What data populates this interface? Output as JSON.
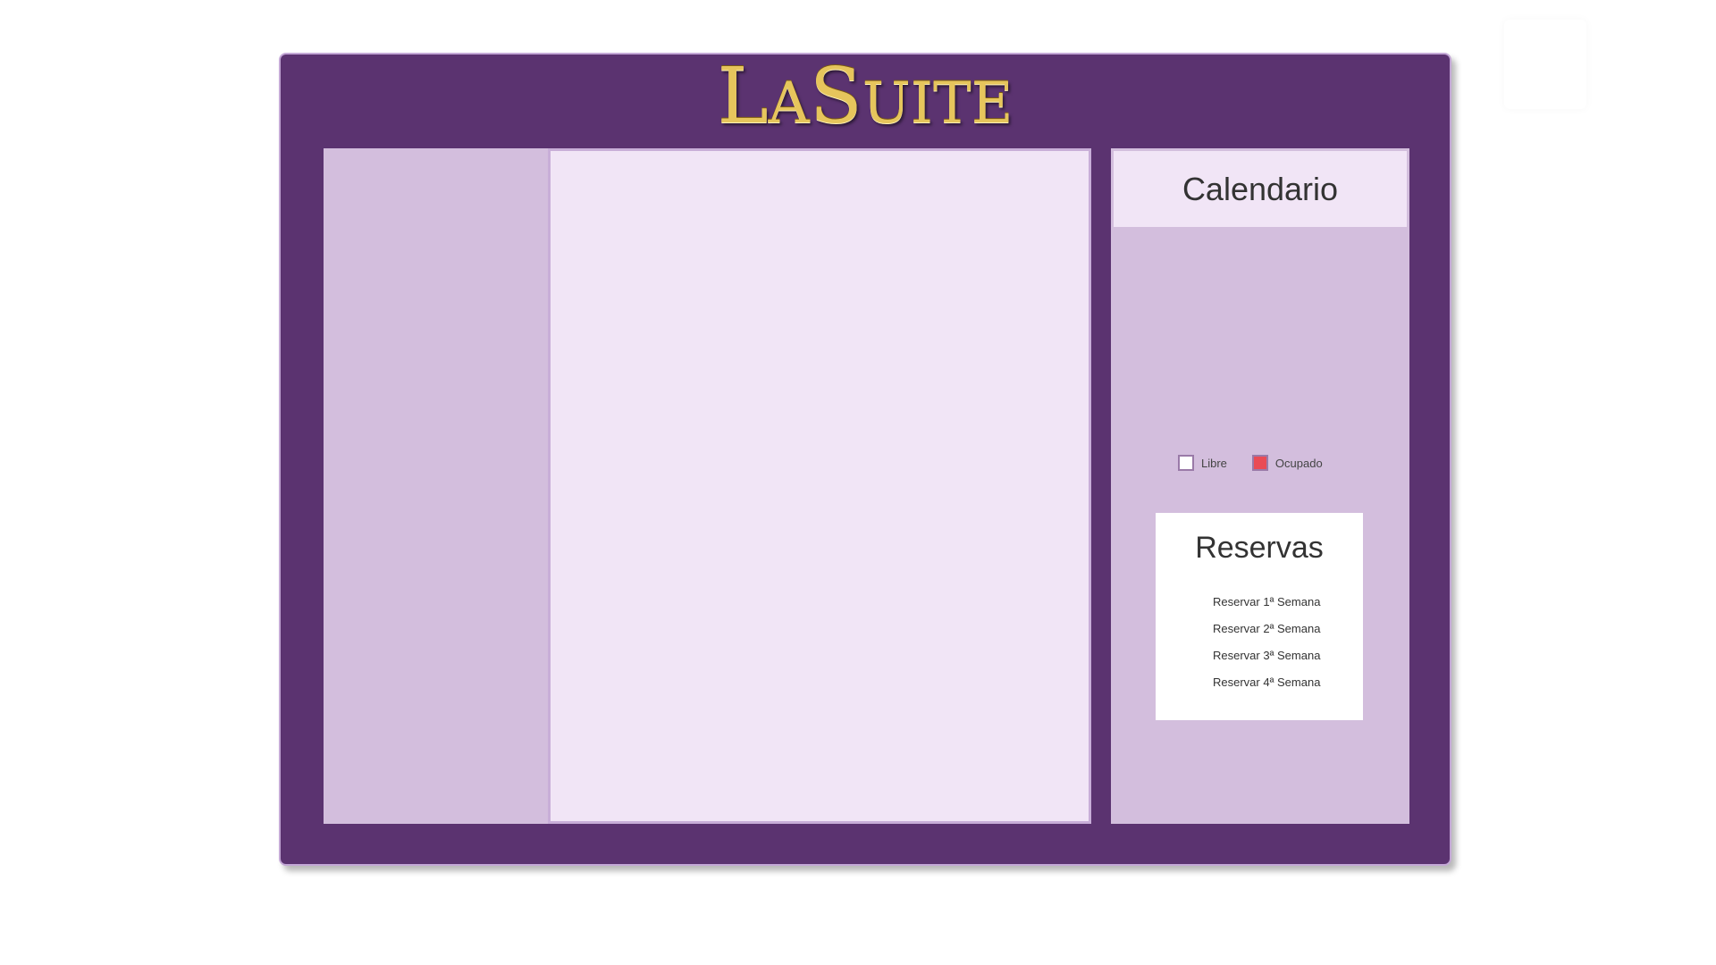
{
  "header": {
    "logo_first_letter": "L",
    "logo_part1": "A",
    "logo_second_letter": "S",
    "logo_part2": "UITE"
  },
  "calendar": {
    "title": "Calendario"
  },
  "legend": {
    "items": [
      {
        "label": "Libre",
        "color": "#ffffff"
      },
      {
        "label": "Ocupado",
        "color": "#e94b55"
      }
    ]
  },
  "reservas": {
    "title": "Reservas",
    "items": [
      {
        "label": "Reservar 1ª Semana"
      },
      {
        "label": "Reservar 2ª Semana"
      },
      {
        "label": "Reservar 3ª Semana"
      },
      {
        "label": "Reservar 4ª Semana"
      }
    ]
  },
  "colors": {
    "frame": "#5b3370",
    "panel": "#d3bedd",
    "panel_light": "#f1e5f6",
    "logo_gold": "#e6c55c"
  }
}
